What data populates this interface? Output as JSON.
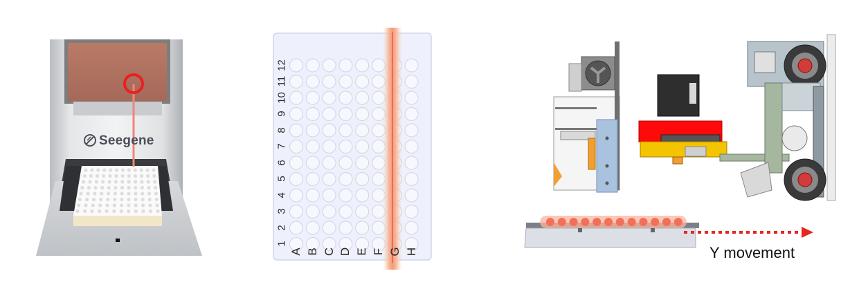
{
  "instrument": {
    "brand": "Seegene",
    "logo_icon": "seegene-logo-icon",
    "highlight_color": "#e83a3a"
  },
  "plate": {
    "rows": [
      "A",
      "B",
      "C",
      "D",
      "E",
      "F",
      "G",
      "H"
    ],
    "columns": [
      "1",
      "2",
      "3",
      "4",
      "5",
      "6",
      "7",
      "8",
      "9",
      "10",
      "11",
      "12"
    ],
    "highlighted_row": "G",
    "plate_color": "#eef1fb",
    "scan_color": "#f4a27c"
  },
  "mechanism": {
    "movement_label": "Y movement",
    "arrow_color": "#e8251f",
    "block_color": "#ff0a0a",
    "carriage_color": "#f5c400"
  }
}
